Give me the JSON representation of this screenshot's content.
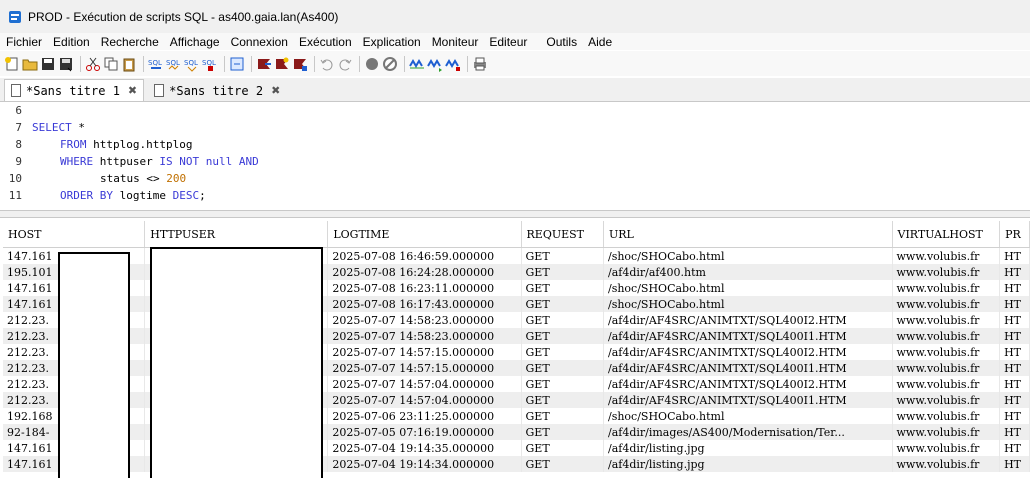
{
  "window": {
    "title": "PROD - Exécution de scripts SQL - as400.gaia.lan(As400)"
  },
  "menu": [
    "Fichier",
    "Edition",
    "Recherche",
    "Affichage",
    "Connexion",
    "Exécution",
    "Explication",
    "Moniteur",
    "Editeur",
    "Outils",
    "Aide"
  ],
  "tabs": [
    {
      "label": "*Sans titre 1",
      "close": "✖"
    },
    {
      "label": "*Sans titre 2",
      "close": "✖"
    }
  ],
  "editor": {
    "line_numbers": [
      "6",
      "7",
      "8",
      "9",
      "10",
      "11"
    ],
    "kw_select": "SELECT",
    "star": " *",
    "kw_from": "FROM",
    "from_table": " httplog.httplog",
    "kw_where": "WHERE",
    "where_col": " httpuser ",
    "kw_is_not_null": "IS NOT null AND",
    "cond_status": "status <> ",
    "cond_value": "200",
    "kw_order_by": "ORDER BY",
    "order_col": " logtime ",
    "kw_desc": "DESC",
    "semicolon": ";"
  },
  "grid": {
    "columns": [
      "HOST",
      "HTTPUSER",
      "LOGTIME",
      "REQUEST",
      "URL",
      "VIRTUALHOST",
      "PR"
    ],
    "rows": [
      [
        "147.161",
        "",
        "2025-07-08 16:46:59.000000",
        "GET",
        "/shoc/SHOCabo.html",
        "www.volubis.fr",
        "HT"
      ],
      [
        "195.101",
        "",
        "2025-07-08 16:24:28.000000",
        "GET",
        "/af4dir/af400.htm",
        "www.volubis.fr",
        "HT"
      ],
      [
        "147.161",
        "",
        "2025-07-08 16:23:11.000000",
        "GET",
        "/shoc/SHOCabo.html",
        "www.volubis.fr",
        "HT"
      ],
      [
        "147.161",
        "",
        "2025-07-08 16:17:43.000000",
        "GET",
        "/shoc/SHOCabo.html",
        "www.volubis.fr",
        "HT"
      ],
      [
        "212.23.",
        "",
        "2025-07-07 14:58:23.000000",
        "GET",
        "/af4dir/AF4SRC/ANIMTXT/SQL400I2.HTM",
        "www.volubis.fr",
        "HT"
      ],
      [
        "212.23.",
        "",
        "2025-07-07 14:58:23.000000",
        "GET",
        "/af4dir/AF4SRC/ANIMTXT/SQL400I1.HTM",
        "www.volubis.fr",
        "HT"
      ],
      [
        "212.23.",
        "",
        "2025-07-07 14:57:15.000000",
        "GET",
        "/af4dir/AF4SRC/ANIMTXT/SQL400I2.HTM",
        "www.volubis.fr",
        "HT"
      ],
      [
        "212.23.",
        "",
        "2025-07-07 14:57:15.000000",
        "GET",
        "/af4dir/AF4SRC/ANIMTXT/SQL400I1.HTM",
        "www.volubis.fr",
        "HT"
      ],
      [
        "212.23.",
        "",
        "2025-07-07 14:57:04.000000",
        "GET",
        "/af4dir/AF4SRC/ANIMTXT/SQL400I2.HTM",
        "www.volubis.fr",
        "HT"
      ],
      [
        "212.23.",
        "",
        "2025-07-07 14:57:04.000000",
        "GET",
        "/af4dir/AF4SRC/ANIMTXT/SQL400I1.HTM",
        "www.volubis.fr",
        "HT"
      ],
      [
        "192.168",
        "",
        "2025-07-06 23:11:25.000000",
        "GET",
        "/shoc/SHOCabo.html",
        "www.volubis.fr",
        "HT"
      ],
      [
        "92-184-",
        "...",
        "2025-07-05 07:16:19.000000",
        "GET",
        "/af4dir/images/AS400/Modernisation/Ter...",
        "www.volubis.fr",
        "HT"
      ],
      [
        "147.161",
        "",
        "2025-07-04 19:14:35.000000",
        "GET",
        "/af4dir/listing.jpg",
        "www.volubis.fr",
        "HT"
      ],
      [
        "147.161",
        "",
        "2025-07-04 19:14:34.000000",
        "GET",
        "/af4dir/listing.jpg",
        "www.volubis.fr",
        "HT"
      ]
    ]
  }
}
